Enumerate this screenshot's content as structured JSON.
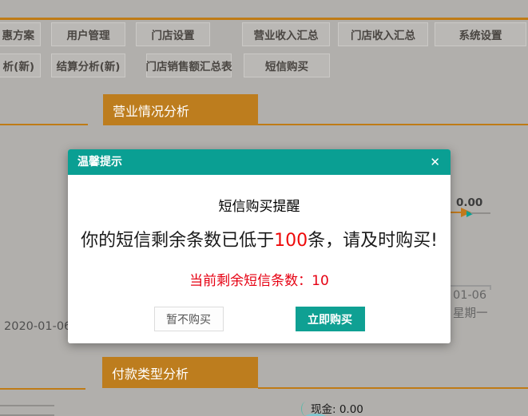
{
  "nav": {
    "row1": [
      "惠方案",
      "用户管理",
      "门店设置",
      "营业收入汇总",
      "门店收入汇总",
      "系统设置"
    ],
    "row2": [
      "析(新)",
      "结算分析(新)",
      "门店销售额汇总表",
      "短信购买"
    ]
  },
  "tabs": {
    "business_analysis": "营业情况分析",
    "payment_type_analysis": "付款类型分析"
  },
  "modal": {
    "title": "温馨提示",
    "close_icon": "✕",
    "heading": "短信购买提醒",
    "message_pre": "你的短信剩余条数已低于",
    "message_highlight": "100",
    "message_post": "条，请及时购买!",
    "remaining_label": "当前剩余短信条数：",
    "remaining_value": "10",
    "later_button": "暂不购买",
    "buy_button": "立即购买"
  },
  "chart": {
    "point_label": "0.00",
    "x_tick_date": "01-06",
    "x_tick_day": "星期一",
    "date_label": "2020-01-06",
    "cash_label": "现金: 0.00"
  },
  "colors": {
    "accent_orange": "#bf7b16",
    "tab_orange": "#bd7d1e",
    "teal": "#0a9f93",
    "alert_red": "#e60012",
    "background_gray": "#b1afac"
  }
}
